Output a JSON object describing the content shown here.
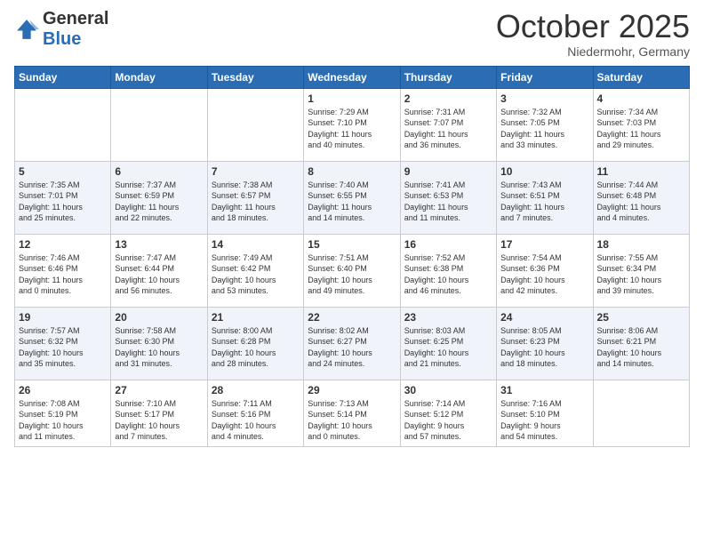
{
  "header": {
    "logo_general": "General",
    "logo_blue": "Blue",
    "month_title": "October 2025",
    "location": "Niedermohr, Germany"
  },
  "weekdays": [
    "Sunday",
    "Monday",
    "Tuesday",
    "Wednesday",
    "Thursday",
    "Friday",
    "Saturday"
  ],
  "weeks": [
    [
      {
        "day": "",
        "info": ""
      },
      {
        "day": "",
        "info": ""
      },
      {
        "day": "",
        "info": ""
      },
      {
        "day": "1",
        "info": "Sunrise: 7:29 AM\nSunset: 7:10 PM\nDaylight: 11 hours\nand 40 minutes."
      },
      {
        "day": "2",
        "info": "Sunrise: 7:31 AM\nSunset: 7:07 PM\nDaylight: 11 hours\nand 36 minutes."
      },
      {
        "day": "3",
        "info": "Sunrise: 7:32 AM\nSunset: 7:05 PM\nDaylight: 11 hours\nand 33 minutes."
      },
      {
        "day": "4",
        "info": "Sunrise: 7:34 AM\nSunset: 7:03 PM\nDaylight: 11 hours\nand 29 minutes."
      }
    ],
    [
      {
        "day": "5",
        "info": "Sunrise: 7:35 AM\nSunset: 7:01 PM\nDaylight: 11 hours\nand 25 minutes."
      },
      {
        "day": "6",
        "info": "Sunrise: 7:37 AM\nSunset: 6:59 PM\nDaylight: 11 hours\nand 22 minutes."
      },
      {
        "day": "7",
        "info": "Sunrise: 7:38 AM\nSunset: 6:57 PM\nDaylight: 11 hours\nand 18 minutes."
      },
      {
        "day": "8",
        "info": "Sunrise: 7:40 AM\nSunset: 6:55 PM\nDaylight: 11 hours\nand 14 minutes."
      },
      {
        "day": "9",
        "info": "Sunrise: 7:41 AM\nSunset: 6:53 PM\nDaylight: 11 hours\nand 11 minutes."
      },
      {
        "day": "10",
        "info": "Sunrise: 7:43 AM\nSunset: 6:51 PM\nDaylight: 11 hours\nand 7 minutes."
      },
      {
        "day": "11",
        "info": "Sunrise: 7:44 AM\nSunset: 6:48 PM\nDaylight: 11 hours\nand 4 minutes."
      }
    ],
    [
      {
        "day": "12",
        "info": "Sunrise: 7:46 AM\nSunset: 6:46 PM\nDaylight: 11 hours\nand 0 minutes."
      },
      {
        "day": "13",
        "info": "Sunrise: 7:47 AM\nSunset: 6:44 PM\nDaylight: 10 hours\nand 56 minutes."
      },
      {
        "day": "14",
        "info": "Sunrise: 7:49 AM\nSunset: 6:42 PM\nDaylight: 10 hours\nand 53 minutes."
      },
      {
        "day": "15",
        "info": "Sunrise: 7:51 AM\nSunset: 6:40 PM\nDaylight: 10 hours\nand 49 minutes."
      },
      {
        "day": "16",
        "info": "Sunrise: 7:52 AM\nSunset: 6:38 PM\nDaylight: 10 hours\nand 46 minutes."
      },
      {
        "day": "17",
        "info": "Sunrise: 7:54 AM\nSunset: 6:36 PM\nDaylight: 10 hours\nand 42 minutes."
      },
      {
        "day": "18",
        "info": "Sunrise: 7:55 AM\nSunset: 6:34 PM\nDaylight: 10 hours\nand 39 minutes."
      }
    ],
    [
      {
        "day": "19",
        "info": "Sunrise: 7:57 AM\nSunset: 6:32 PM\nDaylight: 10 hours\nand 35 minutes."
      },
      {
        "day": "20",
        "info": "Sunrise: 7:58 AM\nSunset: 6:30 PM\nDaylight: 10 hours\nand 31 minutes."
      },
      {
        "day": "21",
        "info": "Sunrise: 8:00 AM\nSunset: 6:28 PM\nDaylight: 10 hours\nand 28 minutes."
      },
      {
        "day": "22",
        "info": "Sunrise: 8:02 AM\nSunset: 6:27 PM\nDaylight: 10 hours\nand 24 minutes."
      },
      {
        "day": "23",
        "info": "Sunrise: 8:03 AM\nSunset: 6:25 PM\nDaylight: 10 hours\nand 21 minutes."
      },
      {
        "day": "24",
        "info": "Sunrise: 8:05 AM\nSunset: 6:23 PM\nDaylight: 10 hours\nand 18 minutes."
      },
      {
        "day": "25",
        "info": "Sunrise: 8:06 AM\nSunset: 6:21 PM\nDaylight: 10 hours\nand 14 minutes."
      }
    ],
    [
      {
        "day": "26",
        "info": "Sunrise: 7:08 AM\nSunset: 5:19 PM\nDaylight: 10 hours\nand 11 minutes."
      },
      {
        "day": "27",
        "info": "Sunrise: 7:10 AM\nSunset: 5:17 PM\nDaylight: 10 hours\nand 7 minutes."
      },
      {
        "day": "28",
        "info": "Sunrise: 7:11 AM\nSunset: 5:16 PM\nDaylight: 10 hours\nand 4 minutes."
      },
      {
        "day": "29",
        "info": "Sunrise: 7:13 AM\nSunset: 5:14 PM\nDaylight: 10 hours\nand 0 minutes."
      },
      {
        "day": "30",
        "info": "Sunrise: 7:14 AM\nSunset: 5:12 PM\nDaylight: 9 hours\nand 57 minutes."
      },
      {
        "day": "31",
        "info": "Sunrise: 7:16 AM\nSunset: 5:10 PM\nDaylight: 9 hours\nand 54 minutes."
      },
      {
        "day": "",
        "info": ""
      }
    ]
  ]
}
